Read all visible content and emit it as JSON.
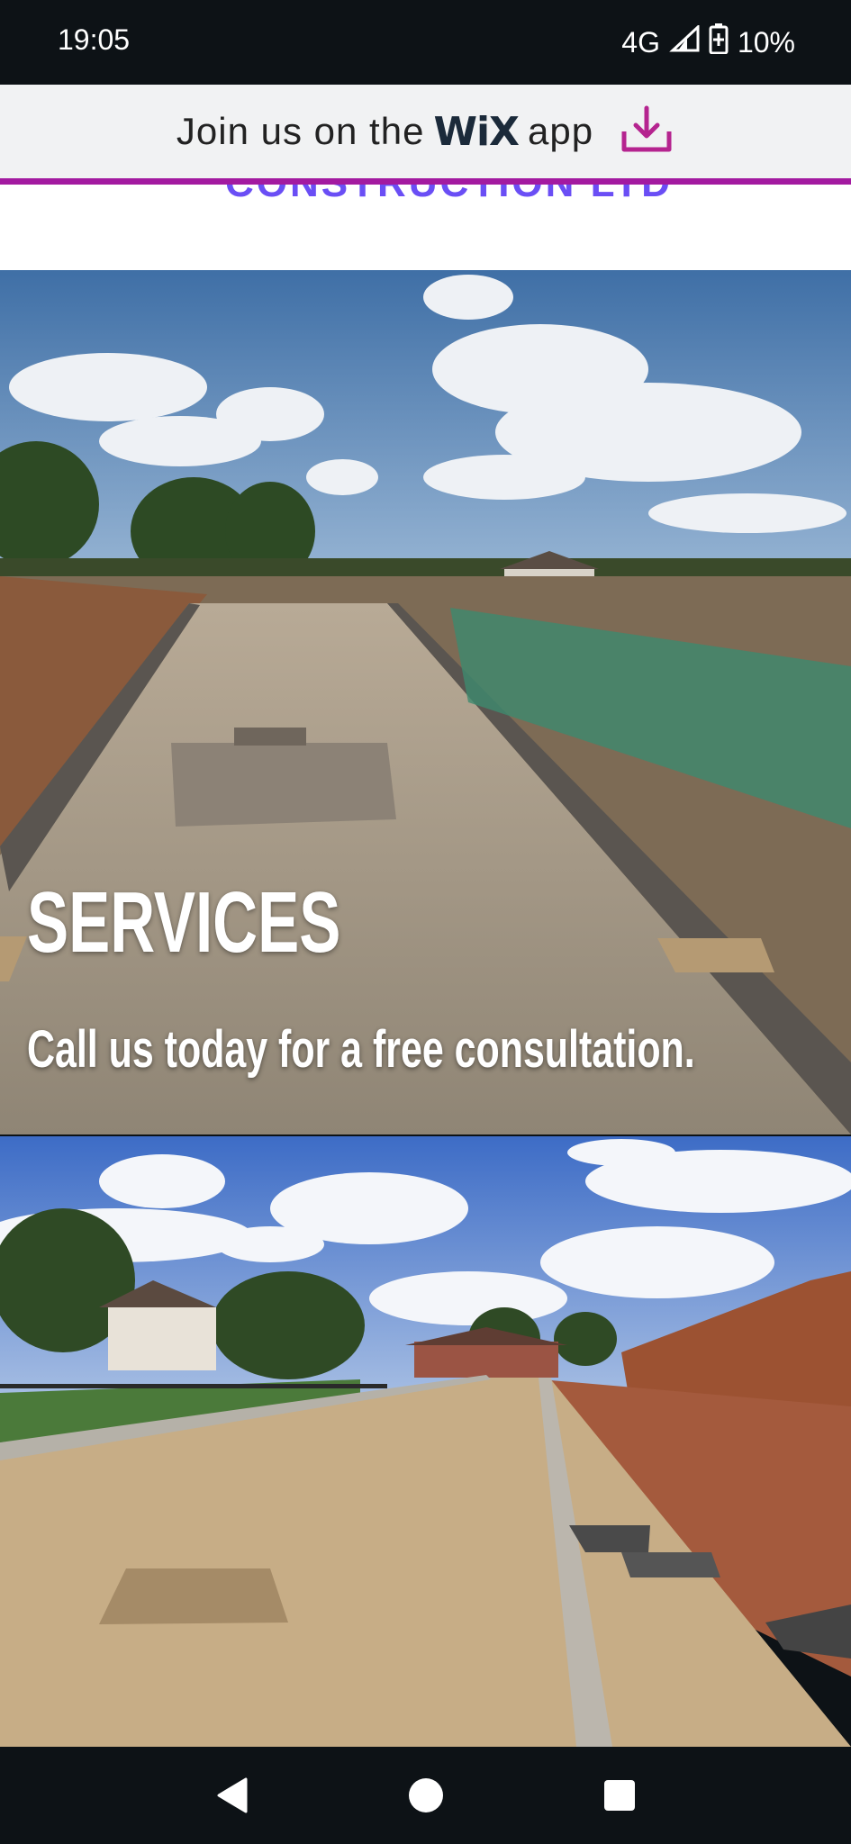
{
  "status_bar": {
    "time": "19:05",
    "network": "4G",
    "battery": "10%"
  },
  "wix_banner": {
    "prefix": "Join us on the",
    "logo": "WiX",
    "suffix": "app",
    "icon": "download-icon",
    "accent_color": "#a31aa0"
  },
  "header": {
    "partial_title": "CONSTRUCTION LTD"
  },
  "hero": {
    "title": "SERVICES",
    "subtitle": "Call us today for a free consultation."
  },
  "nav_bar": {
    "back_icon": "back-icon",
    "home_icon": "home-icon",
    "recents_icon": "recents-icon"
  }
}
